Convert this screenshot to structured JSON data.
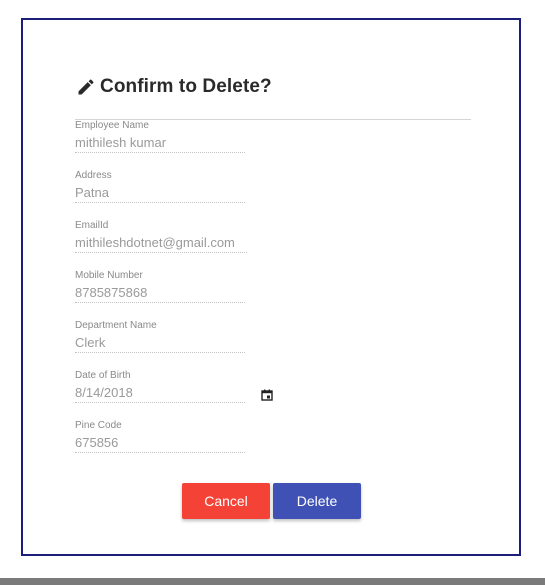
{
  "dialog": {
    "title": "Confirm to Delete?",
    "title_icon": "pencil-icon"
  },
  "fields": {
    "employee_name": {
      "label": "Employee Name",
      "value": "mithilesh kumar"
    },
    "address": {
      "label": "Address",
      "value": "Patna"
    },
    "email": {
      "label": "EmailId",
      "value": "mithileshdotnet@gmail.com"
    },
    "mobile": {
      "label": "Mobile Number",
      "value": "8785875868"
    },
    "department": {
      "label": "Department Name",
      "value": "Clerk"
    },
    "dob": {
      "label": "Date of Birth",
      "value": "8/14/2018",
      "icon": "calendar-icon"
    },
    "pin_code": {
      "label": "Pine Code",
      "value": "675856"
    }
  },
  "actions": {
    "cancel_label": "Cancel",
    "delete_label": "Delete"
  },
  "colors": {
    "border": "#1b1f7a",
    "cancel": "#f44336",
    "delete": "#3f51b5"
  }
}
